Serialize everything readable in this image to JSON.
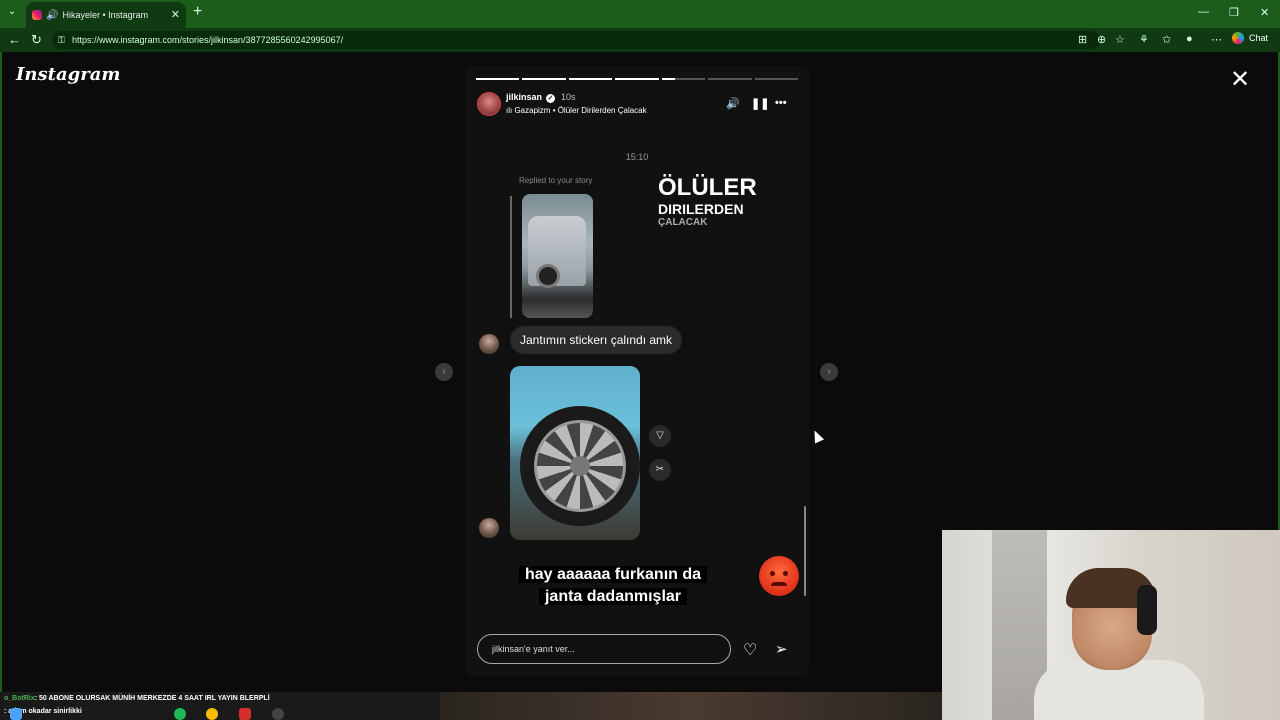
{
  "browser": {
    "tab_title": "Hikayeler • Instagram",
    "url": "https://www.instagram.com/stories/jilkinsan/3877285560242995067/",
    "chat_label": "Chat"
  },
  "page": {
    "logo": "Instagram",
    "close_glyph": "✕",
    "prev_glyph": "‹",
    "next_glyph": "›"
  },
  "story": {
    "username": "jilkinsan",
    "time_ago": "10s",
    "music": "Gazapizm • Ölüler Dirilerden Çalacak",
    "progress": [
      1,
      1,
      1,
      1,
      0.3,
      0,
      0
    ],
    "timestamp": "15:10",
    "replied_label": "Replied to your story",
    "sticker": {
      "line1": "ÖLÜLER",
      "line2": "DIRILERDEN",
      "line3": "ÇALACAK"
    },
    "message": "Jantımın stickerı çalındı amk",
    "caption_line1": "hay aaaaaa furkanın da",
    "caption_line2": "janta dadanmışlar",
    "reply_placeholder": "jilkinsan'e yanıt ver..."
  },
  "overlay": {
    "chat1_user": "o_BotRix",
    "chat1_text": ": 50 ABONE OLURSAK MÜNİH MERKEZDE 4 SAAT IRL YAYIN BLERPLİ",
    "chat2_user": "",
    "chat2_text": ": adam okadar sinirlikki"
  },
  "colors": {
    "chrome_green": "#1c5d1c",
    "story_bg": "#111111",
    "angry_emoji": "#e0301a"
  }
}
